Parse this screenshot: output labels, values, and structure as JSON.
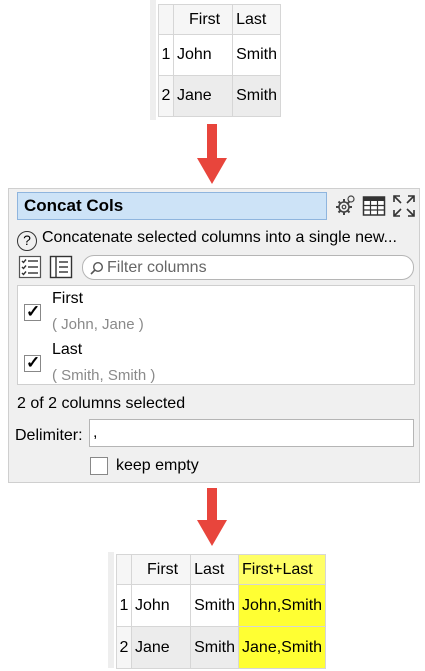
{
  "input_table": {
    "headers": [
      "First",
      "Last"
    ],
    "rows": [
      {
        "num": "1",
        "cells": [
          "John",
          "Smith"
        ]
      },
      {
        "num": "2",
        "cells": [
          "Jane",
          "Smith"
        ]
      }
    ]
  },
  "dialog": {
    "title": "Concat Cols",
    "description": "Concatenate selected columns into a single new...",
    "filter_placeholder": "Filter columns",
    "columns": [
      {
        "name": "First",
        "values": "( John, Jane )",
        "checked": true
      },
      {
        "name": "Last",
        "values": "( Smith, Smith )",
        "checked": true
      }
    ],
    "selected_count": "2 of 2 columns selected",
    "delimiter_label": "Delimiter:",
    "delimiter_value": ",",
    "keep_empty_label": "keep empty"
  },
  "output_table": {
    "headers": [
      "First",
      "Last",
      "First+Last"
    ],
    "rows": [
      {
        "num": "1",
        "cells": [
          "John",
          "Smith",
          "John,Smith"
        ]
      },
      {
        "num": "2",
        "cells": [
          "Jane",
          "Smith",
          "Jane,Smith"
        ]
      }
    ]
  },
  "colors": {
    "arrow": "#e8453c",
    "title_bg": "#cde3f7",
    "highlight": "#ffff33"
  }
}
